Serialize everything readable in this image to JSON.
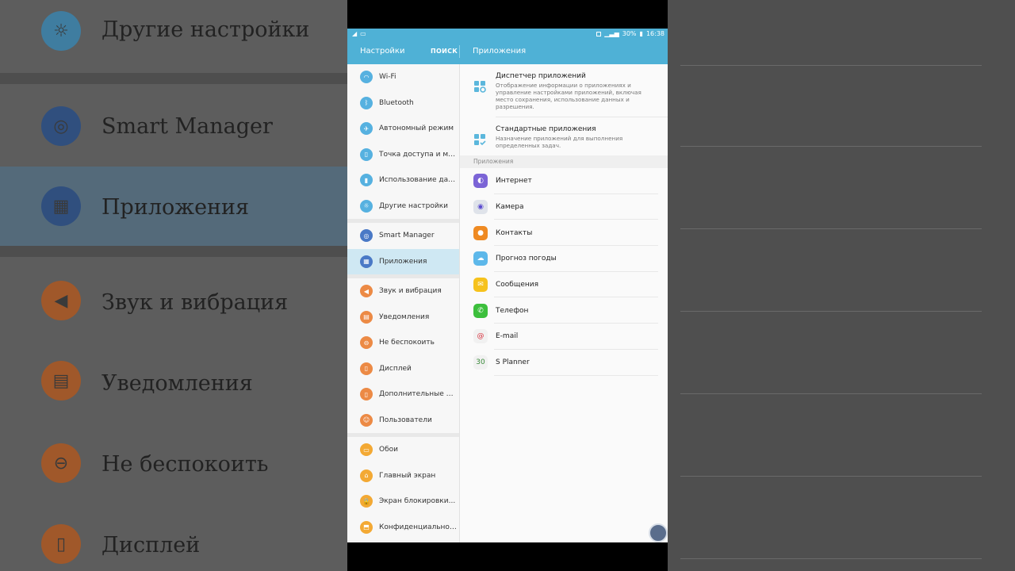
{
  "status": {
    "battery": "30%",
    "time": "16:38"
  },
  "appbar": {
    "title": "Настройки",
    "search": "ПОИСК",
    "right_title": "Приложения"
  },
  "nav": {
    "group1": [
      {
        "label": "Wi-Fi",
        "icon": "wifi-icon",
        "color": "#56b1e0",
        "glyph": "◠"
      },
      {
        "label": "Bluetooth",
        "icon": "bluetooth-icon",
        "color": "#56b1e0",
        "glyph": "ᛒ"
      },
      {
        "label": "Автономный режим",
        "icon": "airplane-icon",
        "color": "#56b1e0",
        "glyph": "✈"
      },
      {
        "label": "Точка доступа и мо...",
        "icon": "hotspot-icon",
        "color": "#56b1e0",
        "glyph": "▯"
      },
      {
        "label": "Использование дан...",
        "icon": "data-usage-icon",
        "color": "#56b1e0",
        "glyph": "▮"
      },
      {
        "label": "Другие настройки",
        "icon": "more-settings-icon",
        "color": "#56b1e0",
        "glyph": "☼"
      }
    ],
    "group2": [
      {
        "label": "Smart Manager",
        "icon": "smart-manager-icon",
        "color": "#4a79c6",
        "glyph": "◎"
      },
      {
        "label": "Приложения",
        "icon": "apps-icon",
        "color": "#4a79c6",
        "glyph": "▦"
      }
    ],
    "group3": [
      {
        "label": "Звук и вибрация",
        "icon": "sound-icon",
        "color": "#ec8a45",
        "glyph": "◀"
      },
      {
        "label": "Уведомления",
        "icon": "notifications-icon",
        "color": "#ec8a45",
        "glyph": "▤"
      },
      {
        "label": "Не беспокоить",
        "icon": "do-not-disturb-icon",
        "color": "#ec8a45",
        "glyph": "⊖"
      },
      {
        "label": "Дисплей",
        "icon": "display-icon",
        "color": "#ec8a45",
        "glyph": "▯"
      },
      {
        "label": "Дополнительные ф...",
        "icon": "advanced-features-icon",
        "color": "#ec8a45",
        "glyph": "▯"
      },
      {
        "label": "Пользователи",
        "icon": "users-icon",
        "color": "#ec8a45",
        "glyph": "☺"
      }
    ],
    "group4": [
      {
        "label": "Обои",
        "icon": "wallpaper-icon",
        "color": "#f3a934",
        "glyph": "▭"
      },
      {
        "label": "Главный экран",
        "icon": "home-screen-icon",
        "color": "#f3a934",
        "glyph": "⌂"
      },
      {
        "label": "Экран блокировки...",
        "icon": "lock-screen-icon",
        "color": "#f3a934",
        "glyph": "🔒"
      },
      {
        "label": "Конфиденциальность",
        "icon": "privacy-icon",
        "color": "#f3a934",
        "glyph": "⬒"
      }
    ]
  },
  "content": {
    "app_manager": {
      "title": "Диспетчер приложений",
      "desc": "Отображение информации о приложениях и управление настройками приложений, включая место сохранения, использование данных и разрешения."
    },
    "default_apps": {
      "title": "Стандартные приложения",
      "desc": "Назначение приложений для выполнения определенных задач."
    },
    "section_header": "Приложения",
    "apps": [
      {
        "label": "Интернет",
        "icon": "internet-icon",
        "color": "#7b64d6",
        "glyph": "◐"
      },
      {
        "label": "Камера",
        "icon": "camera-icon",
        "color": "#dfe3ea",
        "glyph": "◉"
      },
      {
        "label": "Контакты",
        "icon": "contacts-icon",
        "color": "#ef8a22",
        "glyph": "●"
      },
      {
        "label": "Прогноз погоды",
        "icon": "weather-icon",
        "color": "#5db8ea",
        "glyph": "☁"
      },
      {
        "label": "Сообщения",
        "icon": "messages-icon",
        "color": "#f6c21c",
        "glyph": "✉"
      },
      {
        "label": "Телефон",
        "icon": "phone-icon",
        "color": "#3cbf3c",
        "glyph": "✆"
      },
      {
        "label": "E-mail",
        "icon": "email-icon",
        "color": "#f1f1f1",
        "glyph": "@"
      },
      {
        "label": "S Planner",
        "icon": "s-planner-icon",
        "color": "#f1f1f1",
        "glyph": "30"
      }
    ]
  },
  "background": {
    "left_rows": [
      {
        "label": "Другие настройки",
        "color": "#3f7da0"
      },
      {
        "label": "Smart Manager",
        "color": "#304f7e"
      },
      {
        "label": "Приложения",
        "color": "#304f7e"
      },
      {
        "label": "Звук и вибрация",
        "color": "#a0582a"
      },
      {
        "label": "Уведомления",
        "color": "#a0582a"
      },
      {
        "label": "Не беспокоить",
        "color": "#a0582a"
      },
      {
        "label": "Дисплей",
        "color": "#a0582a"
      }
    ]
  }
}
